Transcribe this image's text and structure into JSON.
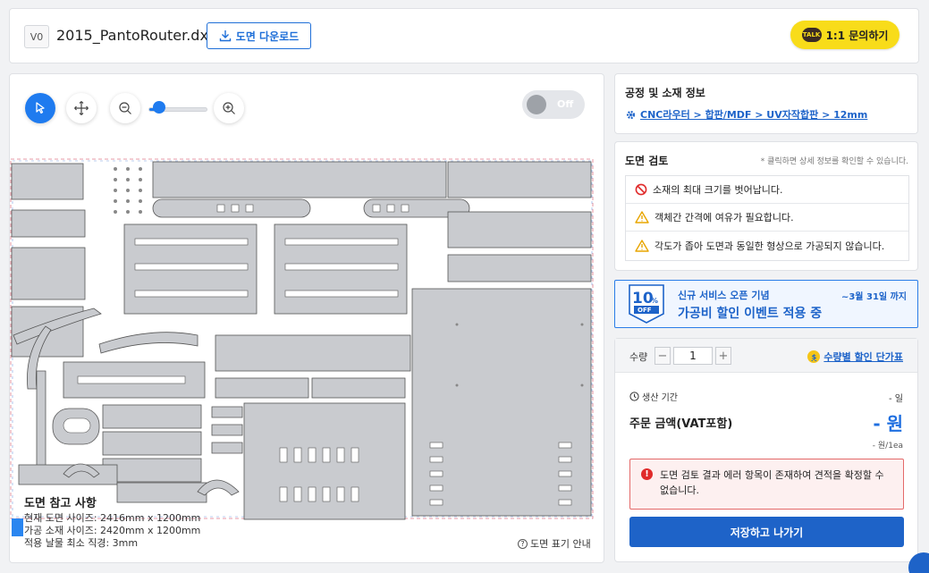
{
  "header": {
    "version": "V0",
    "filename": "2015_PantoRouter.dxf",
    "download_label": "도면 다운로드",
    "talk_badge": "TALK",
    "inquiry_label": "1:1 문의하기"
  },
  "canvas": {
    "toggle_label": "Off",
    "info_title": "도면 참고 사항",
    "info_lines": [
      "현재 도면 사이즈: 2416mm x 1200mm",
      "가공 소재 사이즈: 2420mm x 1200mm",
      "적용 날물 최소 직경: 3mm"
    ],
    "legend_link": "도면 표기 안내"
  },
  "process": {
    "title": "공정 및 소재 정보",
    "path": "CNC라우터 > 합판/MDF > UV자작합판 > 12mm"
  },
  "review": {
    "title": "도면 검토",
    "hint": "* 클릭하면 상세 정보를 확인할 수 있습니다.",
    "items": [
      {
        "icon": "prohibited-icon",
        "text": "소재의 최대 크기를 벗어납니다."
      },
      {
        "icon": "warning-icon",
        "text": "객체간 간격에 여유가 필요합니다."
      },
      {
        "icon": "warning-icon",
        "text": "각도가 좁아 도면과 동일한 형상으로 가공되지 않습니다."
      }
    ]
  },
  "promo": {
    "badge_pct": "10",
    "badge_unit": "%",
    "badge_off": "OFF",
    "subtitle": "신규 서비스 오픈 기념",
    "title": "가공비 할인 이벤트 적용 중",
    "date": "~3월 31일 까지"
  },
  "order": {
    "qty_label": "수량",
    "qty_value": "1",
    "minus": "−",
    "plus": "+",
    "discount_coin": "$",
    "discount_link": "수량별 할인 단가표",
    "production_label": "생산 기간",
    "production_value": "- 일",
    "price_label": "주문 금액(VAT포함)",
    "price_value": "- 원",
    "per_ea": "- 원/1ea",
    "error_text": "도면 검토 결과 에러 항목이 존재하여 견적을 확정할 수 없습니다.",
    "save_label": "저장하고 나가기"
  },
  "colors": {
    "accent": "#1f7bef",
    "primary_button": "#1e63c8",
    "kakao": "#f8dc1a",
    "error": "#e02b2b",
    "part_fill": "#c9cbcf"
  }
}
